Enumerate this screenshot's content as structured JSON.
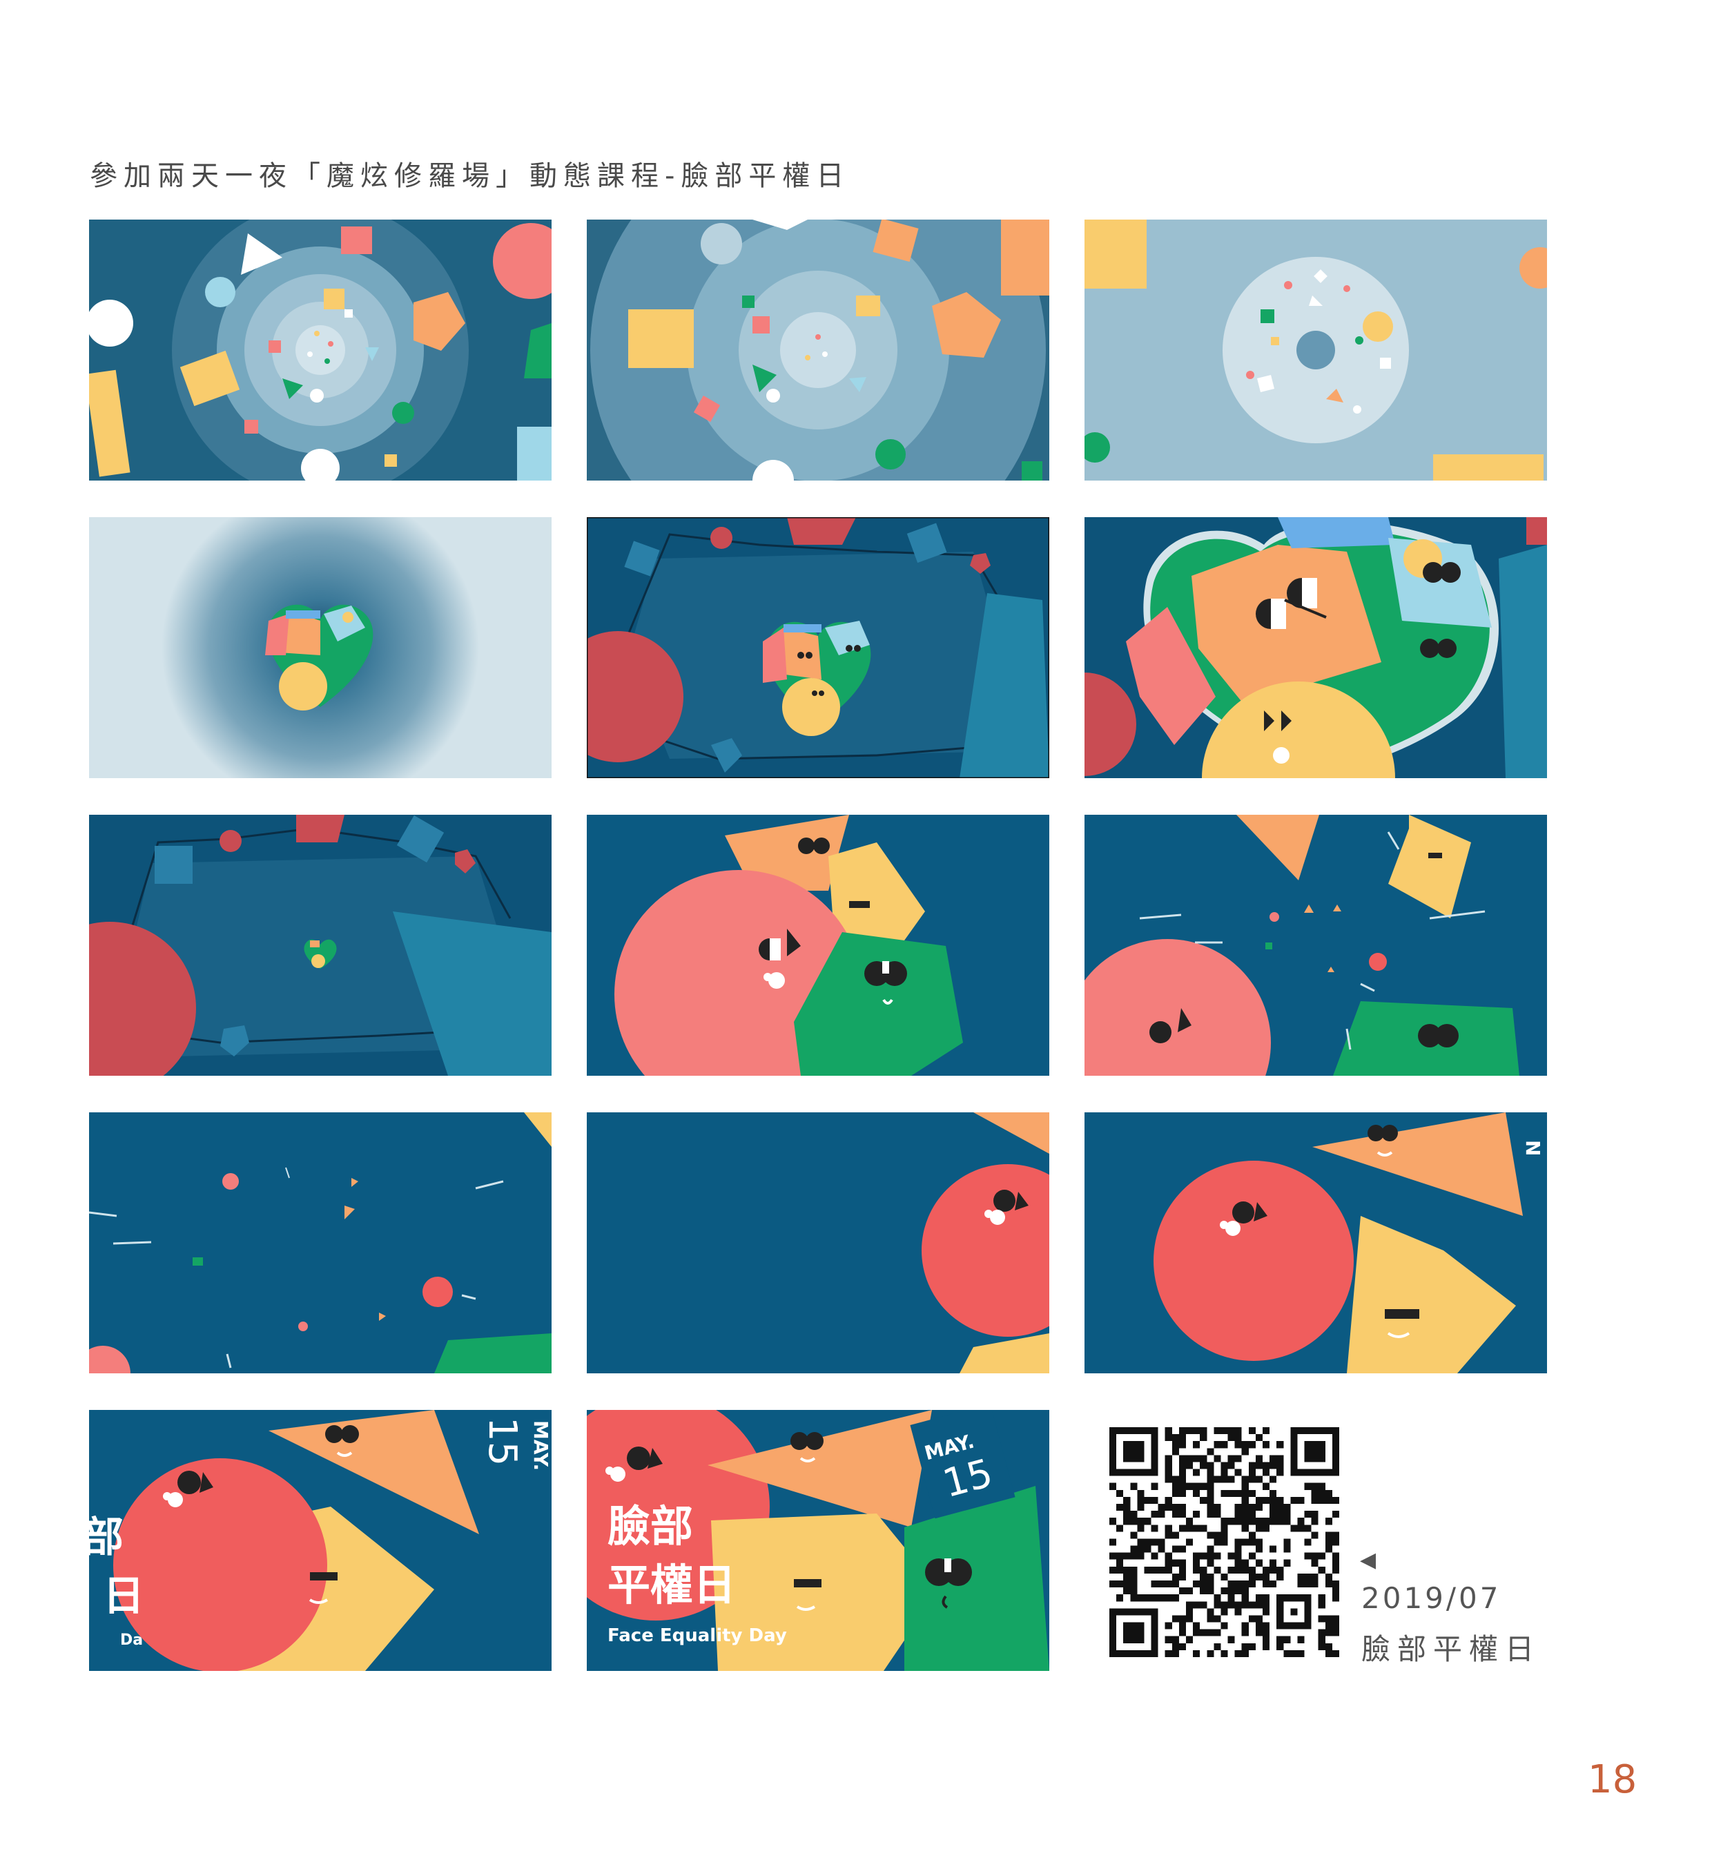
{
  "page": {
    "heading": "參加兩天一夜「魔炫修羅場」動態課程-臉部平權日",
    "page_number": "18"
  },
  "frames": [
    {
      "label": ""
    },
    {
      "label": ""
    },
    {
      "label": ""
    },
    {
      "label": ""
    },
    {
      "label": ""
    },
    {
      "label": ""
    },
    {
      "label": ""
    },
    {
      "label": ""
    },
    {
      "label": ""
    },
    {
      "label": ""
    },
    {
      "label": ""
    },
    {
      "label": ""
    },
    {
      "partial_text": "部",
      "partial_text2": "日",
      "partial_sub": "Da",
      "month": "MAY.",
      "day": "15"
    },
    {
      "title_line1": "臉部",
      "title_line2": "平權日",
      "subtitle": "Face Equality Day",
      "month": "MAY.",
      "day": "15"
    }
  ],
  "qr_block": {
    "arrow": "◀",
    "date": "2019/07",
    "title": "臉部平權日"
  },
  "colors": {
    "navy": "#0b5a82",
    "deep_blue": "#1b5d7e",
    "coral": "#f47e7c",
    "red": "#f05d5d",
    "orange": "#f8a66a",
    "yellow": "#f9cc6d",
    "green": "#14a564",
    "light_blue": "#9fd7e8",
    "page_number": "#c8603a"
  }
}
